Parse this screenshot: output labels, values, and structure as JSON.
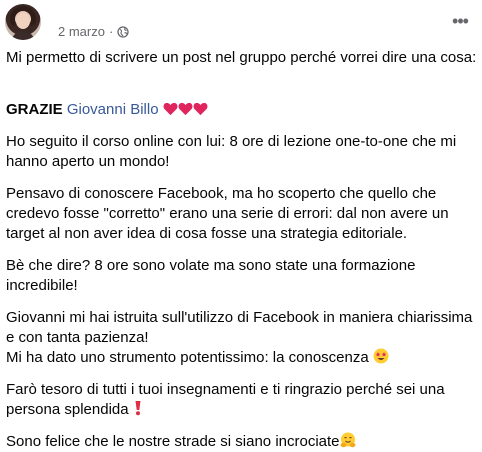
{
  "post": {
    "date": "2 marzo",
    "separator": "·",
    "paragraphs": [
      "Mi permetto di scrivere un post nel gruppo perché vorrei dire una cosa:",
      "Ho seguito il corso online con lui: 8 ore di lezione one-to-one che mi hanno aperto un mondo!",
      "Pensavo di conoscere Facebook, ma ho scoperto che quello che credevo fosse \"corretto\" erano una serie di errori: dal non avere un target al non aver idea di cosa fosse una strategia editoriale.",
      "Bè che dire? 8 ore sono volate ma sono state una formazione incredibile!",
      "Giovanni mi hai istruita sull'utilizzo di Facebook in maniera chiarissima e con tanta pazienza!",
      "Mi ha dato uno strumento potentissimo: la conoscenza",
      "Farò tesoro di tutti i tuoi insegnamenti e ti ringrazio perché sei una persona splendida",
      "Sono felice che le nostre strade si siano incrociate"
    ],
    "thanks_word": "GRAZIE",
    "mention": "Giovanni Billo"
  },
  "icons": {
    "globe": "globe-icon",
    "more": "more-options-icon",
    "hearts": "red-heart-icon",
    "star_struck": "star-struck-emoji",
    "exclamation": "red-exclamation-emoji",
    "hug": "hugging-face-emoji"
  },
  "colors": {
    "mention": "#385898",
    "meta": "#65676b",
    "text": "#050505"
  }
}
